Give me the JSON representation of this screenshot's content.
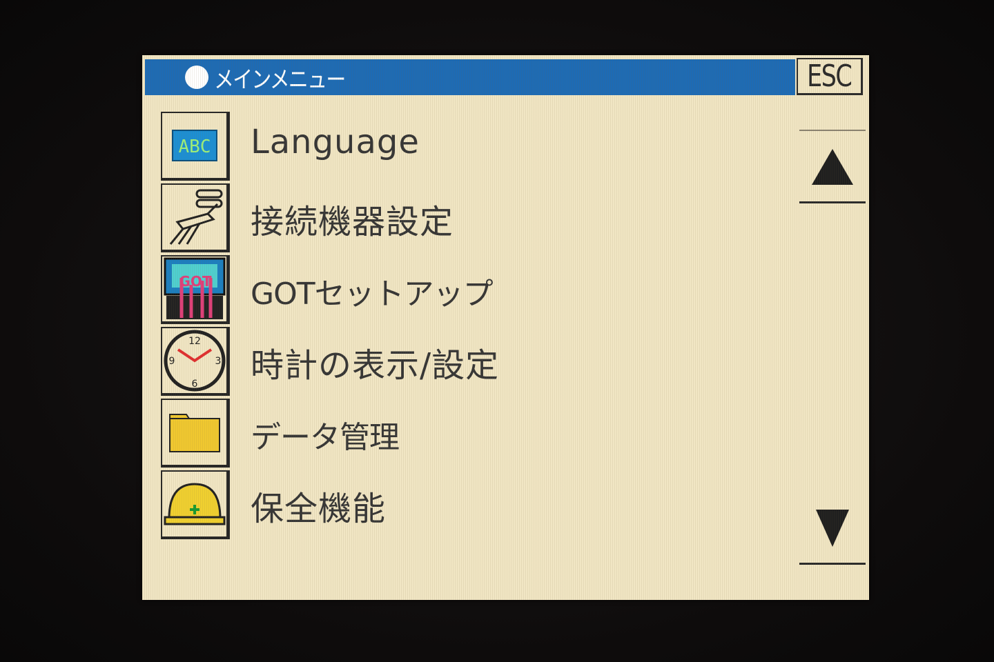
{
  "header": {
    "title": "メインメニュー",
    "esc_label": "ESC"
  },
  "menu": {
    "items": [
      {
        "label": "Language",
        "icon": "abc-icon"
      },
      {
        "label": "接続機器設定",
        "icon": "connector-icon"
      },
      {
        "label": "GOTセットアップ",
        "icon": "monitor-setup-icon"
      },
      {
        "label": "時計の表示/設定",
        "icon": "clock-icon"
      },
      {
        "label": "データ管理",
        "icon": "folder-icon"
      },
      {
        "label": "保全機能",
        "icon": "helmet-icon"
      }
    ]
  },
  "colors": {
    "title_bar": "#1d6bb5",
    "screen_bg": "#f1e6c4",
    "text": "#363636"
  }
}
